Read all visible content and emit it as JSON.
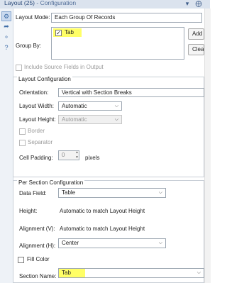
{
  "window": {
    "title": "Layout (25)",
    "title_sep": " - ",
    "subtitle": "Configuration",
    "icons": [
      "chevron-down-icon",
      "pin-icon"
    ]
  },
  "sidebar": {
    "icons": [
      "gear-icon",
      "arrow-circle-icon",
      "tag-icon",
      "help-icon"
    ]
  },
  "layout": {
    "mode_label": "Layout Mode:",
    "mode_value": "Each Group Of Records",
    "group_by_label": "Group By:",
    "group_by_items": [
      {
        "label": "Tab",
        "checked": true
      }
    ],
    "add_button": "Add",
    "clear_button": "Clear",
    "include_source_label": "Include Source Fields in Output",
    "include_source_checked": false
  },
  "layout_config": {
    "header": "Layout Configuration",
    "orientation_label": "Orientation:",
    "orientation_value": "Vertical with Section Breaks",
    "width_label": "Layout Width:",
    "width_value": "Automatic",
    "height_label": "Layout Height:",
    "height_value": "Automatic",
    "border_label": "Border",
    "separator_label": "Separator",
    "cell_padding_label": "Cell Padding:",
    "cell_padding_value": "0",
    "cell_padding_unit": "pixels"
  },
  "section_config": {
    "header": "Per Section Configuration",
    "data_field_label": "Data Field:",
    "data_field_value": "Table",
    "height_label": "Height:",
    "height_value": "Automatic to match Layout Height",
    "align_v_label": "Alignment (V):",
    "align_v_value": "Automatic to match Layout Height",
    "align_h_label": "Alignment (H):",
    "align_h_value": "Center",
    "fill_color_label": "Fill Color",
    "fill_color_checked": false,
    "section_name_label": "Section Name:",
    "section_name_value": "Tab"
  },
  "colors": {
    "highlight": "#ffff66",
    "title_text": "#2b4a7a",
    "accent_icon": "#3f6ea8"
  }
}
